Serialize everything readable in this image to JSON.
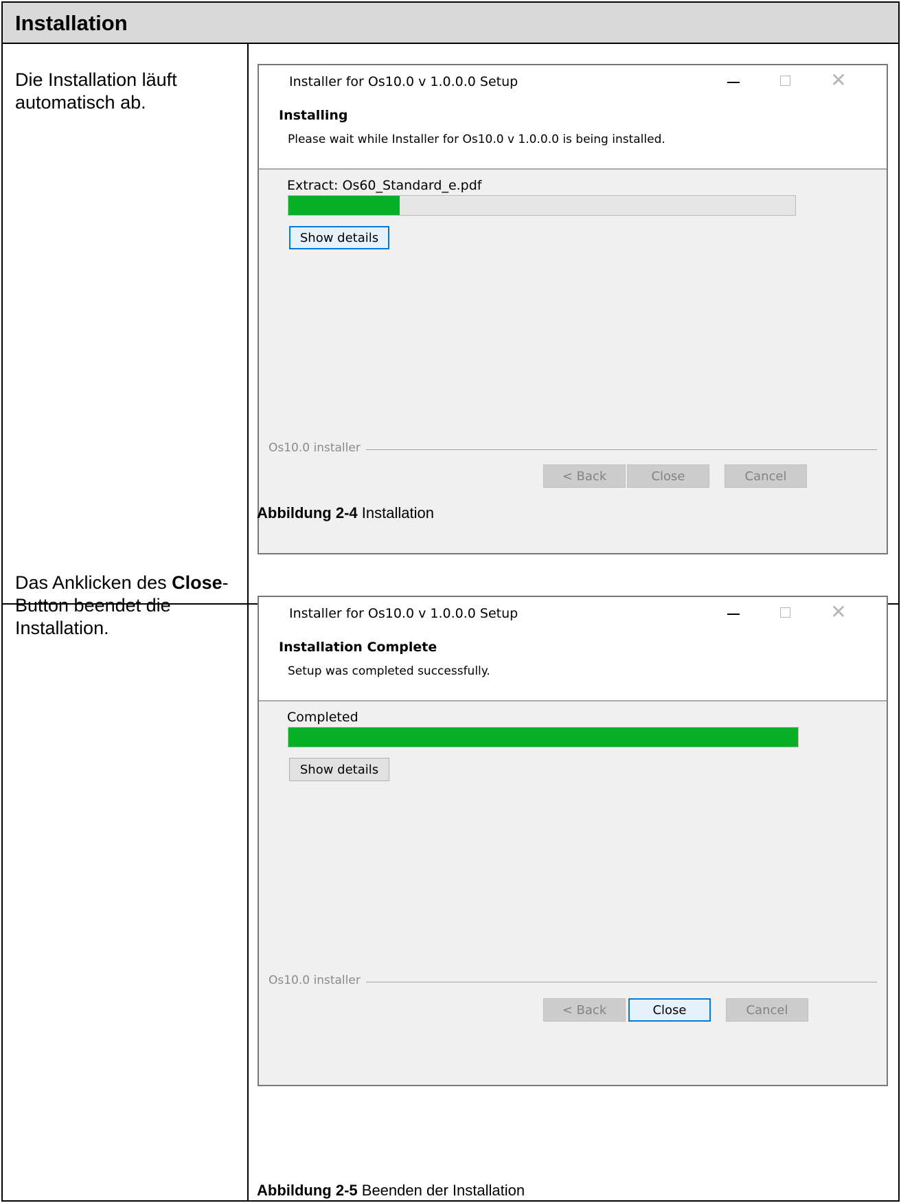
{
  "section": {
    "title": "Installation"
  },
  "rows": [
    {
      "description": "Die Installation läuft automatisch ab.",
      "dialog": {
        "window_title": "Installer for Os10.0 v 1.0.0.0 Setup",
        "heading": "Installing",
        "subheading": "Please wait while Installer for Os10.0 v 1.0.0.0 is being installed.",
        "status": "Extract: Os60_Standard_e.pdf",
        "progress_percent": 22,
        "show_details_label": "Show details",
        "group_label": "Os10.0 installer",
        "back_label": "< Back",
        "close_label": "Close",
        "cancel_label": "Cancel"
      },
      "caption_prefix": "Abbildung 2-4",
      "caption_text": " Installation"
    },
    {
      "description_before": "Das Anklicken des ",
      "description_bold": "Close",
      "description_after": "-Button beendet die Installation.",
      "dialog": {
        "window_title": "Installer for Os10.0 v 1.0.0.0 Setup",
        "heading": "Installation Complete",
        "subheading": "Setup was completed successfully.",
        "status": "Completed",
        "progress_percent": 100,
        "show_details_label": "Show details",
        "group_label": "Os10.0 installer",
        "back_label": "< Back",
        "close_label": "Close",
        "cancel_label": "Cancel"
      },
      "caption_prefix": "Abbildung 2-5",
      "caption_text": " Beenden der Installation"
    }
  ]
}
